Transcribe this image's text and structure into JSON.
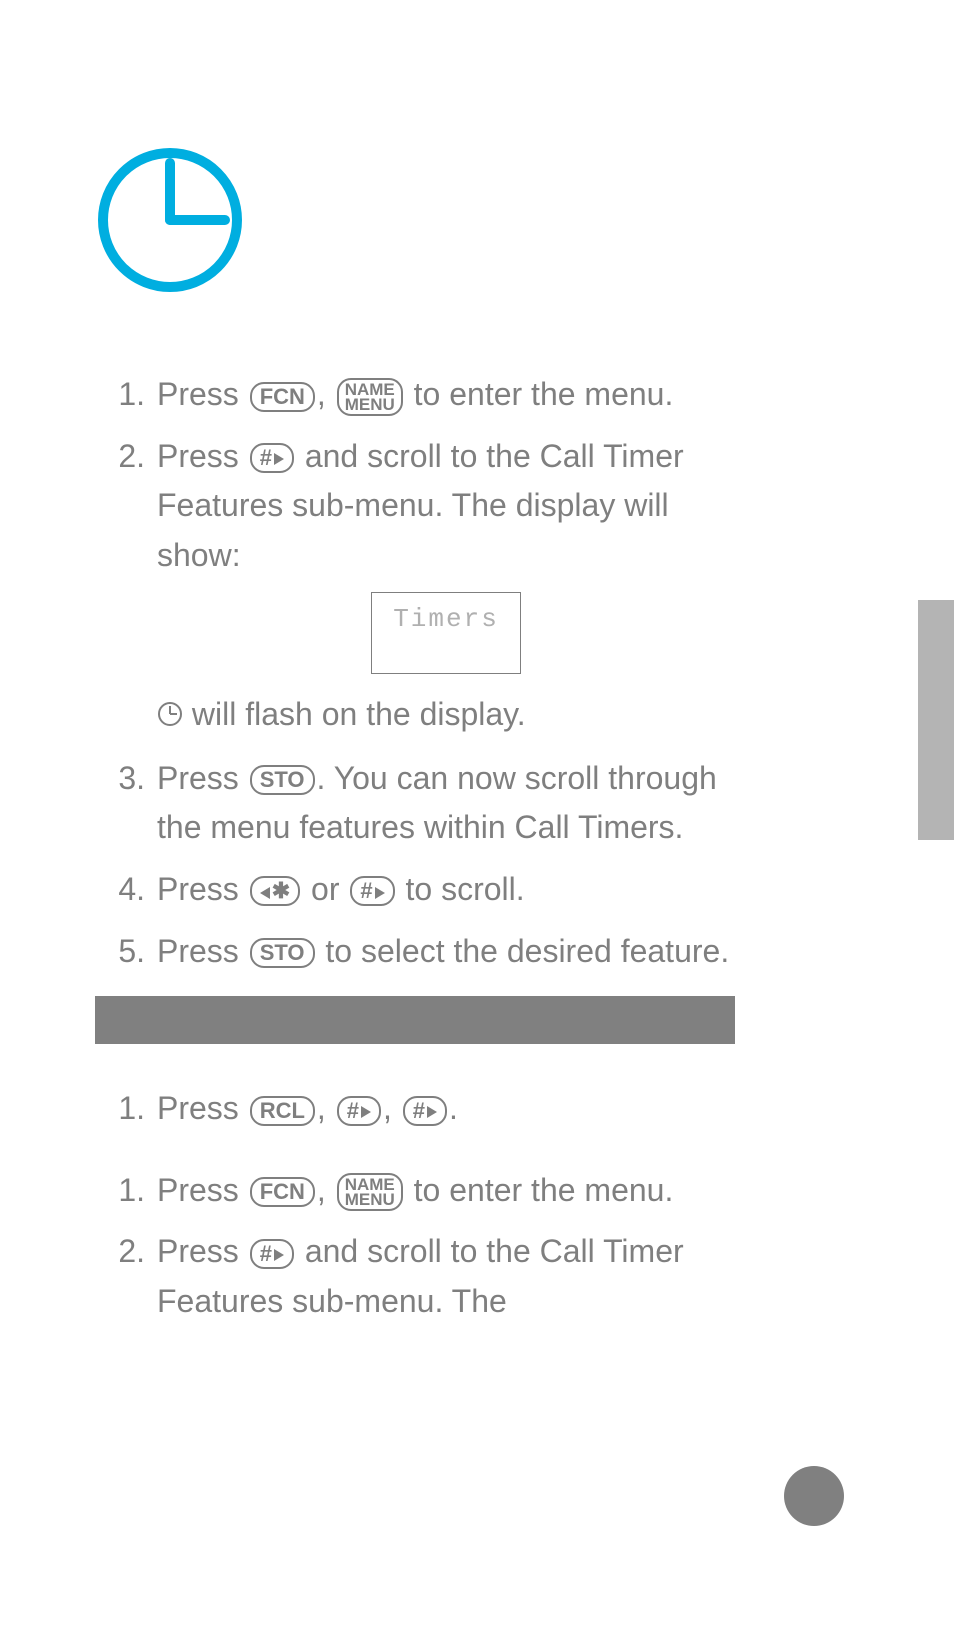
{
  "icons": {
    "main_clock": "clock-icon",
    "inline_clock": "clock-small-icon"
  },
  "keys": {
    "fcn": "FCN",
    "name_menu_l1": "NAME",
    "name_menu_l2": "MENU",
    "hash_right": "#",
    "sto": "STO",
    "star_left": "✱",
    "rcl": "RCL"
  },
  "steps_a": {
    "s1_pre": "Press ",
    "s1_mid": ", ",
    "s1_post": " to enter the menu.",
    "s2_pre": "Press ",
    "s2_post": " and scroll to the Call Timer Features sub-menu. The display will show:",
    "display_text": "Timers",
    "s2b": " will flash on the display.",
    "s3_pre": "Press ",
    "s3_post": ". You can now scroll through the menu features within Call Timers.",
    "s4_pre": "Press ",
    "s4_mid": " or ",
    "s4_post": " to scroll.",
    "s5_pre": "Press ",
    "s5_post": " to select the desired feature."
  },
  "steps_b": {
    "s1_pre": "Press ",
    "s1_c1": ", ",
    "s1_c2": ", ",
    "s1_post": "."
  },
  "steps_c": {
    "s1_pre": "Press ",
    "s1_mid": ", ",
    "s1_post": " to enter the menu.",
    "s2_pre": "Press ",
    "s2_post": " and scroll to the Call Timer Features sub-menu. The"
  }
}
